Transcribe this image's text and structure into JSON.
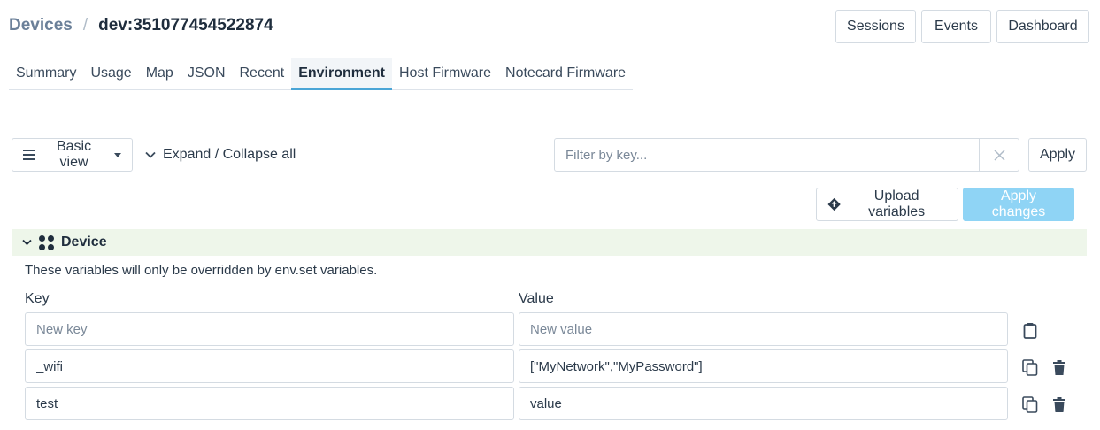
{
  "breadcrumb": {
    "root": "Devices",
    "separator": "/",
    "current": "dev:351077454522874"
  },
  "header_buttons": {
    "sessions": "Sessions",
    "events": "Events",
    "dashboard": "Dashboard"
  },
  "tabs": [
    {
      "label": "Summary",
      "active": false
    },
    {
      "label": "Usage",
      "active": false
    },
    {
      "label": "Map",
      "active": false
    },
    {
      "label": "JSON",
      "active": false
    },
    {
      "label": "Recent",
      "active": false
    },
    {
      "label": "Environment",
      "active": true
    },
    {
      "label": "Host Firmware",
      "active": false
    },
    {
      "label": "Notecard Firmware",
      "active": false
    }
  ],
  "toolbar": {
    "view_label": "Basic view",
    "expand_label": "Expand / Collapse all",
    "filter_placeholder": "Filter by key...",
    "apply_label": "Apply",
    "upload_label": "Upload variables",
    "apply_changes_label": "Apply changes"
  },
  "device_section": {
    "title": "Device",
    "description": "These variables will only be overridden by env.set variables.",
    "key_header": "Key",
    "value_header": "Value",
    "new_key_placeholder": "New key",
    "new_value_placeholder": "New value",
    "rows": [
      {
        "key": "_wifi",
        "value": "[\"MyNetwork\",\"MyPassword\"]"
      },
      {
        "key": "test",
        "value": "value"
      }
    ]
  },
  "colors": {
    "accent": "#4aa5d6",
    "apply_changes_bg": "#8fd4f5",
    "section_bg": "#eef6ea",
    "breadcrumb_root": "#6b8099"
  }
}
